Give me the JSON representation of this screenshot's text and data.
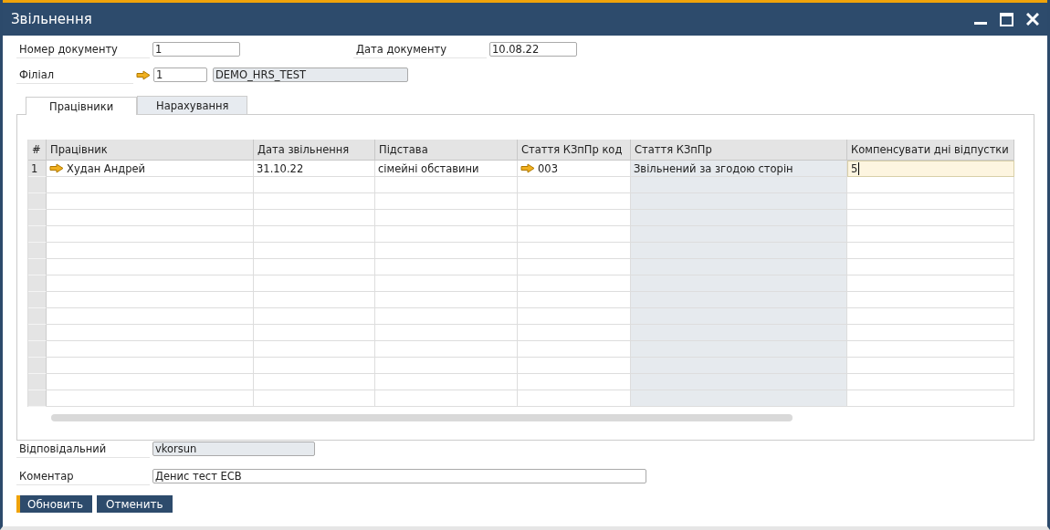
{
  "window": {
    "title": "Звільнення"
  },
  "header": {
    "doc_number": {
      "label": "Номер документу",
      "value": "1"
    },
    "doc_date": {
      "label": "Дата документу",
      "value": "10.08.22"
    },
    "branch": {
      "label": "Філіал",
      "code": "1",
      "name": "DEMO_HRS_TEST",
      "name_readonly": true
    }
  },
  "tabs": [
    {
      "label": "Працівники",
      "selected": true
    },
    {
      "label": "Нарахування",
      "selected": false
    }
  ],
  "table": {
    "columns": [
      {
        "label": "#"
      },
      {
        "label": "Працівник",
        "readonly": false
      },
      {
        "label": "Дата звільнення",
        "readonly": false
      },
      {
        "label": "Підстава",
        "readonly": false
      },
      {
        "label": "Стаття КЗпПр код",
        "readonly": false
      },
      {
        "label": "Стаття КЗпПр",
        "readonly": true
      },
      {
        "label": "Компенсувати дні відпустки",
        "readonly": false
      }
    ],
    "rows": [
      {
        "cells": [
          {
            "value": "1",
            "link": false,
            "focused": false
          },
          {
            "value": "Худан Андрей",
            "link": true,
            "focused": false
          },
          {
            "value": "31.10.22",
            "link": false,
            "focused": false
          },
          {
            "value": "сімейні обставини",
            "link": false,
            "focused": false
          },
          {
            "value": "003",
            "link": true,
            "focused": false
          },
          {
            "value": "Звільнений за згодою сторін",
            "link": false,
            "focused": false
          },
          {
            "value": "5",
            "link": false,
            "focused": true
          }
        ]
      }
    ]
  },
  "footer": {
    "responsible": {
      "label": "Відповідальний",
      "value": "vkorsun",
      "readonly": true
    },
    "comment": {
      "label": "Коментар",
      "value": "Денис тест ЕСВ",
      "readonly": false
    }
  },
  "buttons": [
    {
      "label": "Обновить",
      "default": true
    },
    {
      "label": "Отменить",
      "default": false
    }
  ]
}
